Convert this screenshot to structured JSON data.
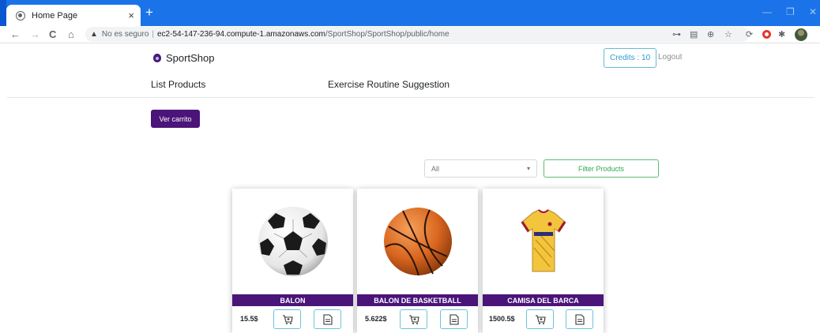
{
  "browser": {
    "tab_title": "Home Page",
    "tab_close": "×",
    "new_tab": "+",
    "window_controls": [
      "—",
      "❐",
      "✕"
    ],
    "nav": {
      "back": "←",
      "forward": "→",
      "reload": "C",
      "home": "⌂"
    },
    "security_warning": "No es seguro",
    "url_host": "ec2-54-147-236-94.compute-1.amazonaws.com",
    "url_path": "/SportShop/SportShop/public/home"
  },
  "header": {
    "brand": "SportShop",
    "credits": "Credits : 10",
    "logout": "Logout"
  },
  "menu": {
    "list_products": "List Products",
    "exercise": "Exercise Routine Suggestion"
  },
  "actions": {
    "view_cart": "Ver carrito"
  },
  "filter": {
    "selected": "All",
    "button": "Filter Products"
  },
  "products": [
    {
      "name": "BALON",
      "price": "15.5$",
      "image": "soccer-ball"
    },
    {
      "name": "BALON DE BASKETBALL",
      "price": "5.622$",
      "image": "basketball"
    },
    {
      "name": "CAMISA DEL BARCA",
      "price": "1500.5$",
      "image": "barca-jersey"
    }
  ],
  "colors": {
    "primary": "#4b1479",
    "browser_blue": "#1a73e8",
    "filter_green": "#2fa84f",
    "credits_blue": "#2e9bd0"
  }
}
